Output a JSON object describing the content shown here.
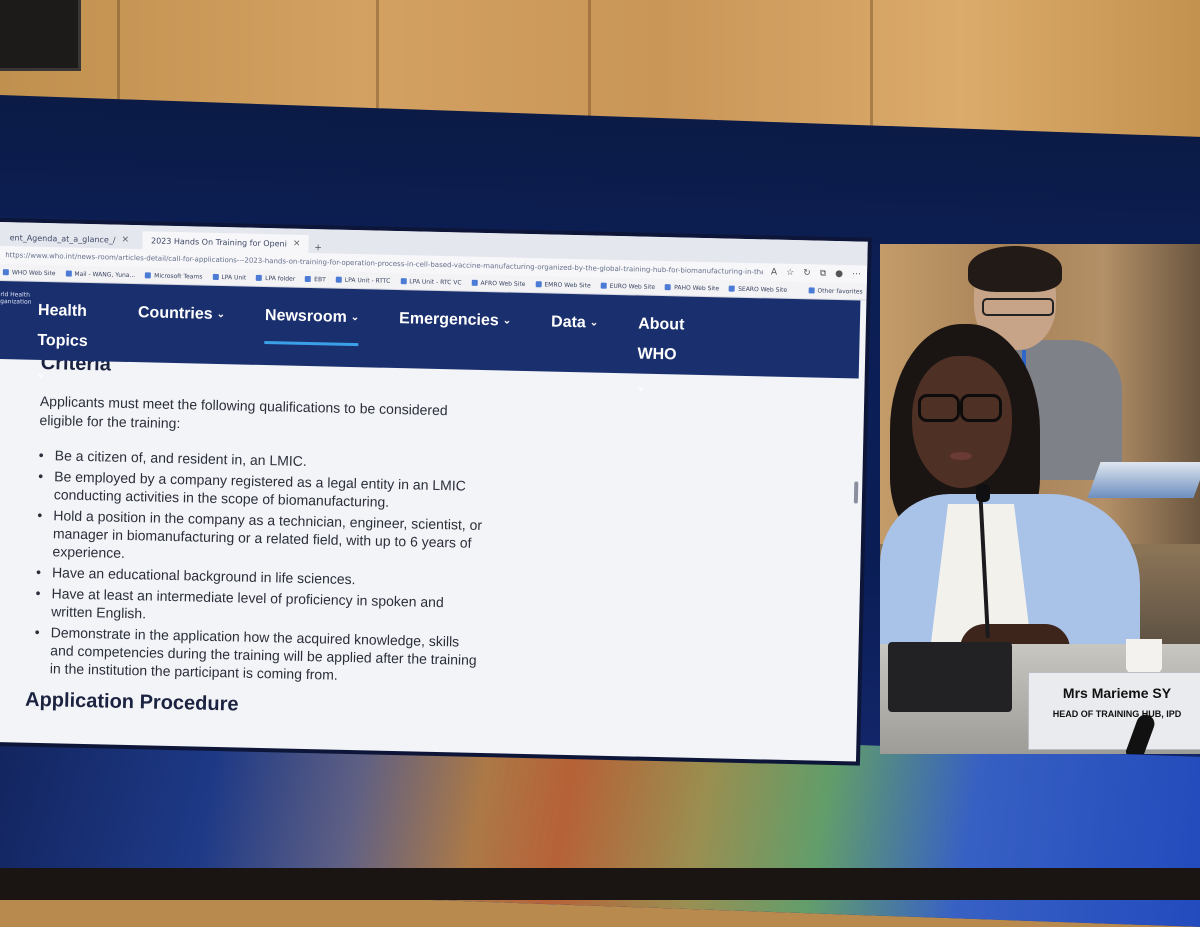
{
  "browser": {
    "tabs": [
      {
        "label": "ent_Agenda_at_a_glance_/",
        "active": false
      },
      {
        "label": "2023 Hands On Training for Openi",
        "active": true
      }
    ],
    "new_tab_glyph": "+",
    "close_glyph": "×",
    "url": "https://www.who.int/news-room/articles-detail/call-for-applications---2023-hands-on-training-for-operation-process-in-cell-based-vaccine-manufacturing-organized-by-the-global-training-hub-for-biomanufacturing-in-the-republic",
    "bookmarks": [
      "WHO Web Site",
      "Mail - WANG, Yuna...",
      "Microsoft Teams",
      "LPA Unit",
      "LPA folder",
      "EBT",
      "LPA Unit - RTTC",
      "LPA Unit - RTC VC",
      "AFRO Web Site",
      "EMRO Web Site",
      "EURO Web Site",
      "PAHO Web Site",
      "SEARO Web Site"
    ],
    "other_favorites": "Other favorites"
  },
  "who_nav": {
    "logo_text": "rld Health\nganization",
    "items": [
      {
        "label": "Health Topics",
        "active": false
      },
      {
        "label": "Countries",
        "active": false
      },
      {
        "label": "Newsroom",
        "active": true
      },
      {
        "label": "Emergencies",
        "active": false
      },
      {
        "label": "Data",
        "active": false
      },
      {
        "label": "About WHO",
        "active": false
      }
    ]
  },
  "article": {
    "section_title": "Criteria",
    "intro": "Applicants must meet the following qualifications to be considered eligible for the training:",
    "criteria": [
      "Be a citizen of, and resident in, an LMIC.",
      "Be employed by a company registered as a legal entity in an LMIC conducting activities in the scope of biomanufacturing.",
      "Hold a position in the company as a technician, engineer, scientist, or manager in biomanufacturing or a related field, with up to 6 years of experience.",
      "Have an educational background in life sciences.",
      "Have at least an intermediate level of proficiency in spoken and written English.",
      "Demonstrate in the application how the acquired knowledge, skills and competencies during the training will be applied after the training in the institution the participant is coming from."
    ],
    "next_section_title": "Application Procedure"
  },
  "video": {
    "speaker_name": "Mrs Marieme SY",
    "speaker_title": "HEAD OF TRAINING HUB, IPD"
  },
  "colors": {
    "who_nav_bg": "#1a2f6e",
    "active_underline": "#3aa0e8",
    "page_bg": "#f3f4f8"
  }
}
